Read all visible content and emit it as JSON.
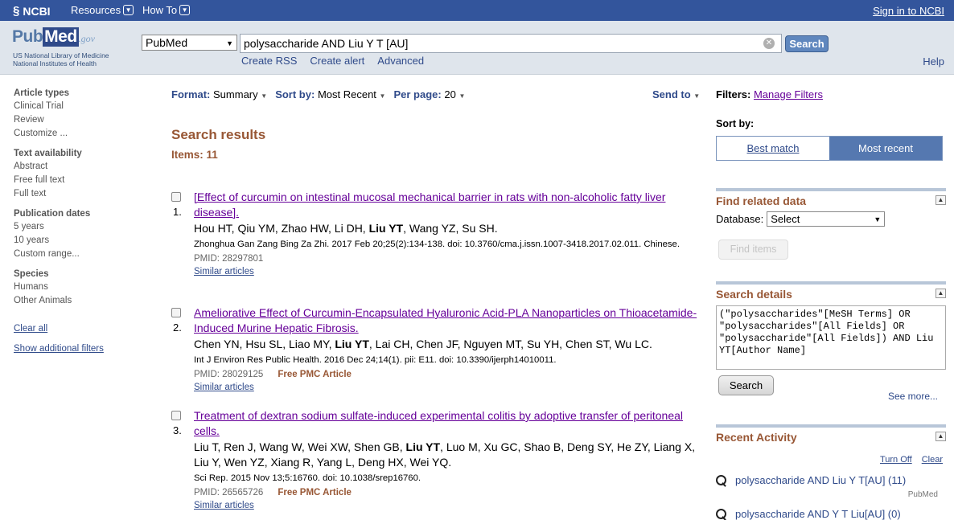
{
  "ncbi_bar": {
    "logo_text": "NCBI",
    "menus": [
      "Resources",
      "How To"
    ],
    "signin": "Sign in to NCBI"
  },
  "header": {
    "logo": {
      "pub": "Pub",
      "med": "Med",
      "gov": ".gov"
    },
    "org_line1": "US National Library of Medicine",
    "org_line2": "National Institutes of Health",
    "database": "PubMed",
    "query": "polysaccharide AND Liu Y T [AU]",
    "search_label": "Search",
    "links": [
      "Create RSS",
      "Create alert",
      "Advanced"
    ],
    "help": "Help"
  },
  "sidebar": {
    "groups": [
      {
        "title": "Article types",
        "items": [
          "Clinical Trial",
          "Review",
          "Customize ..."
        ]
      },
      {
        "title": "Text availability",
        "items": [
          "Abstract",
          "Free full text",
          "Full text"
        ]
      },
      {
        "title": "Publication dates",
        "items": [
          "5 years",
          "10 years",
          "Custom range..."
        ]
      },
      {
        "title": "Species",
        "items": [
          "Humans",
          "Other Animals"
        ]
      }
    ],
    "clear_all": "Clear all",
    "show_filters": "Show additional filters"
  },
  "display": {
    "format_label": "Format:",
    "format_value": "Summary",
    "sort_label": "Sort by:",
    "sort_value": "Most Recent",
    "perpage_label": "Per page:",
    "perpage_value": "20",
    "send_to": "Send to"
  },
  "results": {
    "title": "Search results",
    "items": "Items: 11",
    "list": [
      {
        "num": "1.",
        "title": "[Effect of curcumin on intestinal mucosal mechanical barrier in rats with non-alcoholic fatty liver disease].",
        "authors_before": "Hou HT, Qiu YM, Zhao HW, Li DH, ",
        "authors_bold": "Liu YT",
        "authors_after": ", Wang YZ, Su SH.",
        "citation": "Zhonghua Gan Zang Bing Za Zhi. 2017 Feb 20;25(2):134-138. doi: 10.3760/cma.j.issn.1007-3418.2017.02.011. Chinese.",
        "pmid": "PMID: 28297801",
        "pmc": "",
        "similar": "Similar articles"
      },
      {
        "num": "2.",
        "title": "Ameliorative Effect of Curcumin-Encapsulated Hyaluronic Acid-PLA Nanoparticles on Thioacetamide-Induced Murine Hepatic Fibrosis.",
        "authors_before": "Chen YN, Hsu SL, Liao MY, ",
        "authors_bold": "Liu YT",
        "authors_after": ", Lai CH, Chen JF, Nguyen MT, Su YH, Chen ST, Wu LC.",
        "citation": "Int J Environ Res Public Health. 2016 Dec 24;14(1). pii: E11. doi: 10.3390/ijerph14010011.",
        "pmid": "PMID: 28029125",
        "pmc": "Free PMC Article",
        "similar": "Similar articles"
      },
      {
        "num": "3.",
        "title": "Treatment of dextran sodium sulfate-induced experimental colitis by adoptive transfer of peritoneal cells.",
        "authors_before": "Liu T, Ren J, Wang W, Wei XW, Shen GB, ",
        "authors_bold": "Liu YT",
        "authors_after": ", Luo M, Xu GC, Shao B, Deng SY, He ZY, Liang X, Liu Y, Wen YZ, Xiang R, Yang L, Deng HX, Wei YQ.",
        "citation": "Sci Rep. 2015 Nov 13;5:16760. doi: 10.1038/srep16760.",
        "pmid": "PMID: 26565726",
        "pmc": "Free PMC Article",
        "similar": "Similar articles"
      }
    ]
  },
  "right": {
    "filters_label": "Filters:",
    "manage_filters": "Manage Filters",
    "sortby_label": "Sort by:",
    "sort_tabs": [
      "Best match",
      "Most recent"
    ],
    "find_related": {
      "title": "Find related data",
      "db_label": "Database:",
      "db_value": "Select",
      "button": "Find items"
    },
    "search_details": {
      "title": "Search details",
      "text": "(\"polysaccharides\"[MeSH Terms] OR \"polysaccharides\"[All Fields] OR \"polysaccharide\"[All Fields]) AND Liu YT[Author Name]",
      "button": "Search",
      "see_more": "See more..."
    },
    "recent": {
      "title": "Recent Activity",
      "turn_off": "Turn Off",
      "clear": "Clear",
      "items": [
        {
          "text": "polysaccharide AND Liu Y T[AU] (11)",
          "source": "PubMed"
        },
        {
          "text": "polysaccharide AND Y T Liu[AU] (0)",
          "source": ""
        }
      ]
    }
  }
}
